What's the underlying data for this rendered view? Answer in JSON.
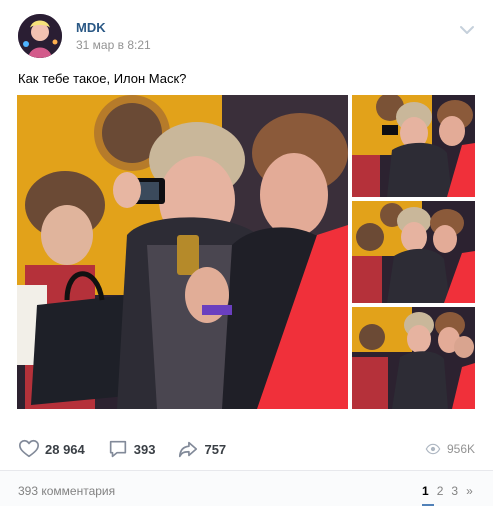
{
  "post": {
    "author": "MDK",
    "date": "31 мар в 8:21",
    "text": "Как тебе такое, Илон Маск?",
    "photos": [
      {
        "label": "main-photo"
      },
      {
        "label": "thumb-1"
      },
      {
        "label": "thumb-2"
      },
      {
        "label": "thumb-3"
      }
    ]
  },
  "actions": {
    "likes": "28 964",
    "comments": "393",
    "shares": "757",
    "views": "956K"
  },
  "footer": {
    "comments_label": "393 комментария",
    "pages": [
      "1",
      "2",
      "3",
      "»"
    ]
  },
  "colors": {
    "link": "#2a5885",
    "icon": "#828a99",
    "muted": "#939393",
    "accent": "#5181b8"
  },
  "icons": {
    "like": "heart-icon",
    "comment": "comment-icon",
    "share": "share-icon",
    "views": "eye-icon",
    "menu": "chevron-down-icon"
  }
}
